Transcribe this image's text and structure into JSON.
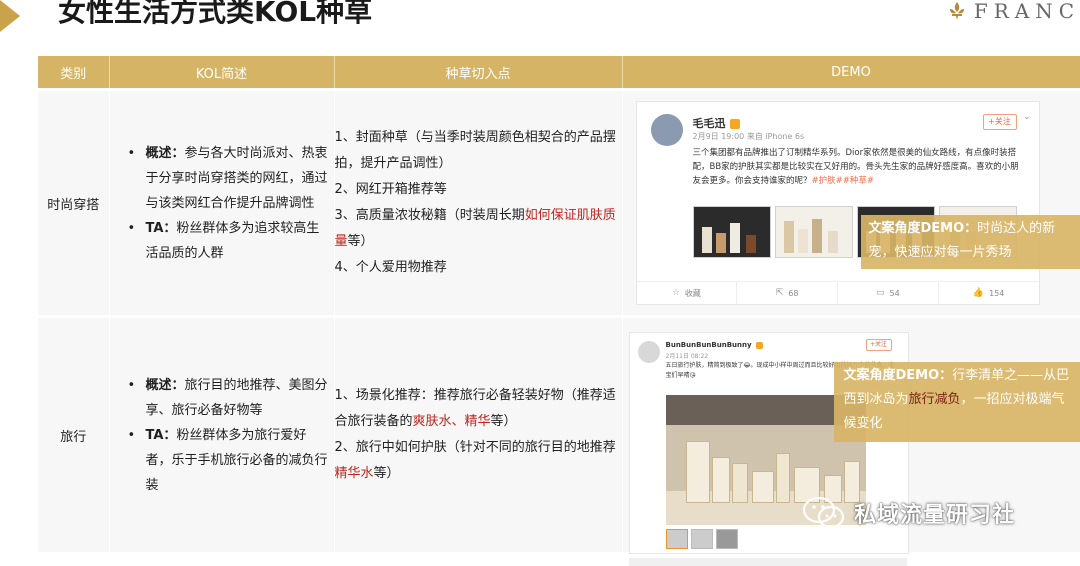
{
  "page": {
    "title": "女性生活方式类KOL种草",
    "logo_text": "FRANC"
  },
  "table": {
    "headers": [
      "类别",
      "KOL简述",
      "种草切入点",
      "DEMO"
    ],
    "rows": [
      {
        "category": "时尚穿搭",
        "desc": [
          {
            "label": "概述：",
            "text": "参与各大时尚派对、热衷于分享时尚穿搭类的网红，通过与该类网红合作提升品牌调性"
          },
          {
            "label": "TA：",
            "text": "粉丝群体多为追求较高生活品质的人群"
          }
        ],
        "points": {
          "p1": "1、封面种草（与当季时装周颜色相契合的产品摆拍，提升产品调性）",
          "p2": "2、网红开箱推荐等",
          "p3_pre": "3、高质量浓妆秘籍（时装周长期",
          "p3_red": "如何保证肌肤质量",
          "p3_post": "等）",
          "p4": "4、个人爱用物推荐"
        },
        "demo": {
          "user": "毛毛迅",
          "meta": "2月9日 19:00 来自 iPhone 6s",
          "follow": "+关注",
          "text": "三个集团都有品牌推出了订制精华系列。Dior家依然是很美的仙女路线，有点像时装搭配，BB家的护肤其实都是比较实在又好用的。骨头先生家的品牌好感度高。喜欢的小朋友会更多。你会支持谁家的呢？",
          "tags": "#护肤##种草#",
          "actions": [
            "收藏",
            "68",
            "54",
            "154"
          ],
          "overlay_label": "文案角度DEMO：",
          "overlay_text": "时尚达人的新宠，快速应对每一片秀场"
        }
      },
      {
        "category": "旅行",
        "desc": [
          {
            "label": "概述：",
            "text": "旅行目的地推荐、美图分享、旅行必备好物等"
          },
          {
            "label": "TA：",
            "text": "粉丝群体多为旅行爱好者，乐于手机旅行必备的减负行装"
          }
        ],
        "points": {
          "p1_pre": "1、场景化推荐：推荐旅行必备轻装好物（推荐适合旅行装备的",
          "p1_red": "爽肤水、精华",
          "p1_post": "等）",
          "p2_pre": "2、旅行中如何护肤（针对不同的旅行目的地推荐",
          "p2_red": "精华水",
          "p2_post": "等）"
        },
        "demo": {
          "user": "BunBunBunBunBunny",
          "meta": "2月11日 08:22",
          "follow": "+关注",
          "text": "五日旅行护肤，精简到极致了😂。现成中小样中周过而且比较好用的抓几个的节奏。宝宝们早晴😘",
          "overlay_label": "文案角度DEMO：",
          "overlay_pre": "行李清单之——从巴西到冰岛为",
          "overlay_mid": "旅行减负",
          "overlay_post": "，一招应对极端气候变化"
        }
      }
    ]
  },
  "watermark": {
    "text": "私域流量研习社"
  },
  "colors": {
    "header_gold": "#d6b465",
    "accent_red": "#c0241c",
    "overlay_gold": "#d8b466"
  }
}
